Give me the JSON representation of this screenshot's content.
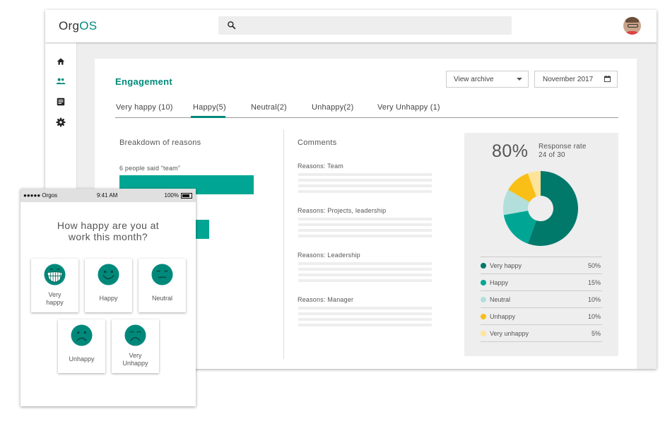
{
  "app": {
    "logo_part1": "Org",
    "logo_part2": "OS"
  },
  "nav": [
    "home-icon",
    "people-icon",
    "list-icon",
    "gear-icon"
  ],
  "page": {
    "title": "Engagement",
    "archive_select": "View archive",
    "date_value": "November 2017",
    "tabs": [
      "Very happy (10)",
      "Happy(5)",
      "Neutral(2)",
      "Unhappy(2)",
      "Very Unhappy (1)"
    ],
    "active_tab": "Happy(5)"
  },
  "breakdown": {
    "heading": "Breakdown of reasons",
    "items": [
      {
        "label": "6 people said “team”",
        "value": 6
      },
      {
        "label": "",
        "value": 4
      },
      {
        "label": "”",
        "value": 0
      }
    ]
  },
  "comments": {
    "heading": "Comments",
    "groups": [
      "Reasons: Team",
      "Reasons: Projects, leadership",
      "Reasons:  Leadership",
      "Reasons:  Manager"
    ]
  },
  "response": {
    "rate": "80%",
    "label": "Response rate",
    "count": "24 of 30"
  },
  "colors": {
    "very_happy": "#00796b",
    "happy": "#00a693",
    "neutral": "#b2dfdb",
    "unhappy": "#f9bf16",
    "very_unhappy": "#fde49a",
    "accent": "#00897b"
  },
  "chart_data": {
    "type": "pie",
    "categories": [
      "Very happy",
      "Happy",
      "Neutral",
      "Unhappy",
      "Very unhappy"
    ],
    "values": [
      50,
      15,
      10,
      10,
      5
    ],
    "value_labels": [
      "50%",
      "15%",
      "10%",
      "10%",
      "5%"
    ]
  },
  "phone": {
    "carrier": "●●●●● Orgos",
    "time": "9:41 AM",
    "battery": "100%",
    "question_line1": "How happy are you at",
    "question_line2": "work this month?",
    "options": [
      {
        "label_line1": "Very",
        "label_line2": "happy",
        "icon": "very-happy-face-icon"
      },
      {
        "label_line1": "Happy",
        "label_line2": "",
        "icon": "happy-face-icon"
      },
      {
        "label_line1": "Neutral",
        "label_line2": "",
        "icon": "neutral-face-icon"
      },
      {
        "label_line1": "Unhappy",
        "label_line2": "",
        "icon": "unhappy-face-icon"
      },
      {
        "label_line1": "Very",
        "label_line2": "Unhappy",
        "icon": "very-unhappy-face-icon"
      }
    ]
  }
}
